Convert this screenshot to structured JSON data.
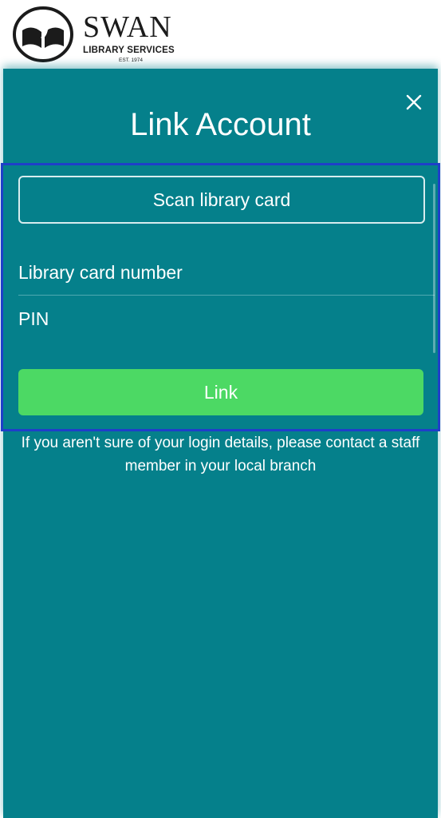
{
  "header": {
    "logo_name": "SWAN",
    "logo_subtitle": "LIBRARY SERVICES",
    "logo_est": "EST. 1974"
  },
  "modal": {
    "title": "Link Account",
    "close_icon": "close-icon",
    "scan_button_label": "Scan library card",
    "card_number_placeholder": "Library card number",
    "card_number_value": "",
    "pin_placeholder": "PIN",
    "pin_value": "",
    "link_button_label": "Link",
    "help_text": "If you aren't sure of your login details, please contact a staff member in your local branch"
  },
  "colors": {
    "modal_background": "#05808b",
    "link_button": "#4cd964",
    "highlight_border": "#1f3fc9",
    "header_background": "#ffffff"
  }
}
